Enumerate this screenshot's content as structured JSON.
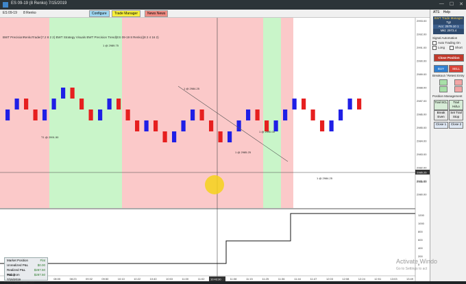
{
  "window": {
    "title": "ES 09-19 (8 Renko)  7/15/2019",
    "minimize_glyph": "—",
    "maximize_glyph": "☐",
    "close_glyph": "✕"
  },
  "toolbar": {
    "instrument": "ES 09-19",
    "bar_type": "8 Renko",
    "configure_label": "Configure",
    "trade_manager_label": "Trade Manager",
    "news_label": "News News"
  },
  "chart_info": "BWT PrecisionRenkoTrader(7.2 8 2 2)  BWT Strategy Visuals  BWT Precision Trend(ES 09-19 8 Renko)(8 2 4 16 2)",
  "chart_data": {
    "type": "renko",
    "bricks": [
      "up",
      "up",
      "down",
      "down",
      "up",
      "up",
      "up",
      "down",
      "down",
      "down",
      "up",
      "up",
      "down",
      "down",
      "down",
      "up",
      "down",
      "down",
      "up",
      "up",
      "up",
      "down",
      "down",
      "down",
      "up",
      "up",
      "up",
      "down",
      "down",
      "up",
      "up",
      "up",
      "down",
      "down",
      "down",
      "up",
      "up",
      "up",
      "down"
    ],
    "price_axis": [
      "2993.00",
      "2992.00",
      "2991.00",
      "2990.00",
      "2989.00",
      "2988.00",
      "2987.00",
      "2986.00",
      "2985.00",
      "2984.00",
      "2983.00",
      "2982.00",
      "2981.00",
      "2980.00"
    ],
    "pnl_axis": [
      "1200",
      "1000",
      "800",
      "600",
      "400",
      "200",
      "0"
    ],
    "time_labels": [
      "06:15",
      "06:42",
      "07:29",
      "08:05",
      "08:23",
      "09:32",
      "09:50",
      "10:10",
      "10:22",
      "10:40",
      "10:53",
      "11:00",
      "11:02",
      "11:05",
      "11:08",
      "11:15",
      "11:25",
      "11:36",
      "11:44",
      "11:47",
      "12:03",
      "12:08",
      "12:24",
      "12:51",
      "13:03",
      "13:49"
    ],
    "crosshair_time": "10:43:30",
    "crosshair_price": "2985.25",
    "last_price": "2988.00",
    "trade_labels": [
      "T1 @ 2991.50",
      "1 @ 2989.75",
      "1 @ 2984.25",
      "1 @ 2985.25",
      "1 @ 2990.00",
      "1 @ 2984.25"
    ],
    "zones": [
      "red",
      "green",
      "red",
      "green",
      "red"
    ]
  },
  "market_panel": {
    "rows": [
      {
        "label": "Market Position",
        "value": "Flat"
      },
      {
        "label": "Unrealized P&L",
        "value": "$0.00"
      },
      {
        "label": "Realized P&L Today",
        "value": "$287.50"
      },
      {
        "label": "P&L from 7/15/2019",
        "value": "$287.50"
      }
    ]
  },
  "copyright": "© 2019 NinjaTrader, LLC",
  "side_panel": {
    "menu": [
      "ATS",
      "Help"
    ],
    "header": "BWT Trade Manager",
    "header_sub": "Tgt",
    "account_line1": "Acc: 2579.10 1",
    "account_line2": "Mkt: 2973.4",
    "signal_automation": "Signal Automation",
    "auto_trading": "Auto Trading On",
    "long_label": "Long",
    "short_label": "Short",
    "close_position": "Close Position",
    "buy": "BUY",
    "sell": "SELL",
    "breakout_label": "Breakout / Retest Entry",
    "position_management": "Position Management",
    "trail_scl": "Trail SCL",
    "trail_hi_lo": "Trail Hi/Lo",
    "break_even": "Break Even",
    "set_trail_stop": "Set Trail Stop",
    "close_1": "Close 1",
    "close_2": "Close 2"
  },
  "watermark": {
    "line1": "Activate Windo",
    "line2": "Go to Settings to act"
  }
}
